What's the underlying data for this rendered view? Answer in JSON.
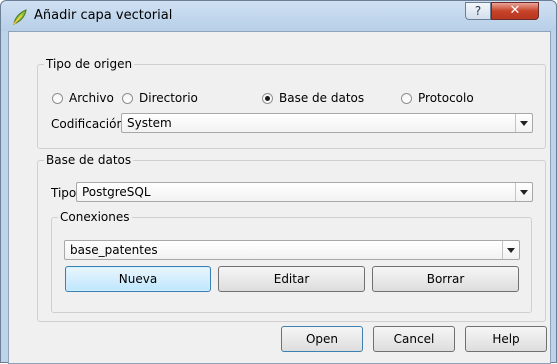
{
  "window": {
    "title": "Añadir capa vectorial",
    "help_glyph": "?",
    "close_glyph": "✕"
  },
  "source_type": {
    "title": "Tipo de origen",
    "options": [
      "Archivo",
      "Directorio",
      "Base de datos",
      "Protocolo"
    ],
    "selected": "Base de datos",
    "encoding_label": "Codificación",
    "encoding_value": "System"
  },
  "database": {
    "title": "Base de datos",
    "type_label": "Tipo",
    "type_value": "PostgreSQL",
    "connections": {
      "title": "Conexiones",
      "selected": "base_patentes",
      "new_label": "Nueva",
      "edit_label": "Editar",
      "delete_label": "Borrar"
    }
  },
  "footer": {
    "open_label": "Open",
    "cancel_label": "Cancel",
    "help_label": "Help"
  },
  "colors": {
    "frame": "#bcd3ea",
    "client": "#f0f0f0",
    "close_button": "#c7432a",
    "default_button": "#bee6fd"
  },
  "icons": {
    "title_icon": "qgis-leaf-icon",
    "dropdown_icon": "chevron-down-icon"
  }
}
